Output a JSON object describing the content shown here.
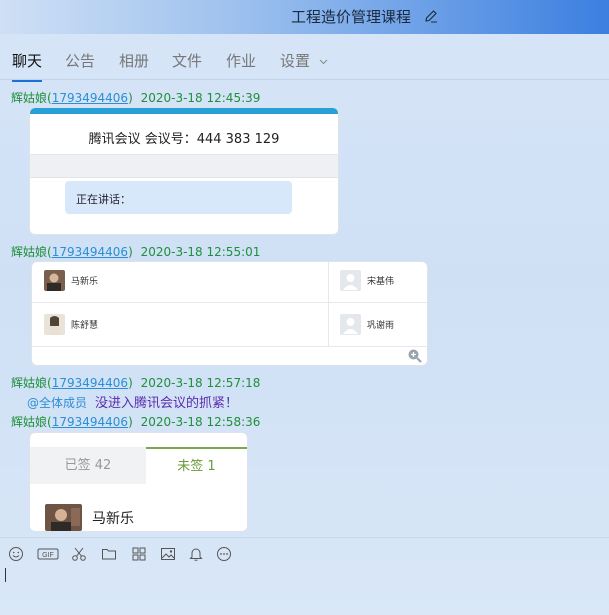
{
  "window": {
    "title": "工程造价管理课程",
    "accent": "#3b7fe0"
  },
  "tabs": [
    {
      "label": "聊天",
      "active": true
    },
    {
      "label": "公告"
    },
    {
      "label": "相册"
    },
    {
      "label": "文件"
    },
    {
      "label": "作业"
    },
    {
      "label": "设置"
    }
  ],
  "messages": [
    {
      "sender": "辉姑娘",
      "paren_open": "(",
      "qq": "1793494406",
      "paren_close": ")",
      "time": "2020-3-18 12:45:39",
      "meeting": {
        "title": "腾讯会议 会议号：444 383 129",
        "speaking_label": "正在讲话："
      }
    },
    {
      "sender": "辉姑娘",
      "paren_open": "(",
      "qq": "1793494406",
      "paren_close": ")",
      "time": "2020-3-18 12:55:01",
      "attendees": [
        {
          "name": "马新乐",
          "avatar": "photo-avatar"
        },
        {
          "name": "宋基伟",
          "avatar": "default-avatar"
        },
        {
          "name": "陈舒慧",
          "avatar": "photo-avatar"
        },
        {
          "name": "巩谢雨",
          "avatar": "default-avatar"
        }
      ]
    },
    {
      "sender": "辉姑娘",
      "paren_open": "(",
      "qq": "1793494406",
      "paren_close": ")",
      "time": "2020-3-18 12:57:18",
      "mention": "@全体成员",
      "text": "没进入腾讯会议的抓紧！"
    },
    {
      "sender": "辉姑娘",
      "paren_open": "(",
      "qq": "1793494406",
      "paren_close": ")",
      "time": "2020-3-18 12:58:36",
      "signin": {
        "signed_label": "已签 42",
        "unsigned_label": "未签 1",
        "unsigned_name": "马新乐"
      }
    }
  ],
  "toolbar": [
    "emoji-icon",
    "gif-icon",
    "scissors-icon",
    "folder-icon",
    "file-icon",
    "image-icon",
    "bell-icon",
    "more-icon"
  ]
}
